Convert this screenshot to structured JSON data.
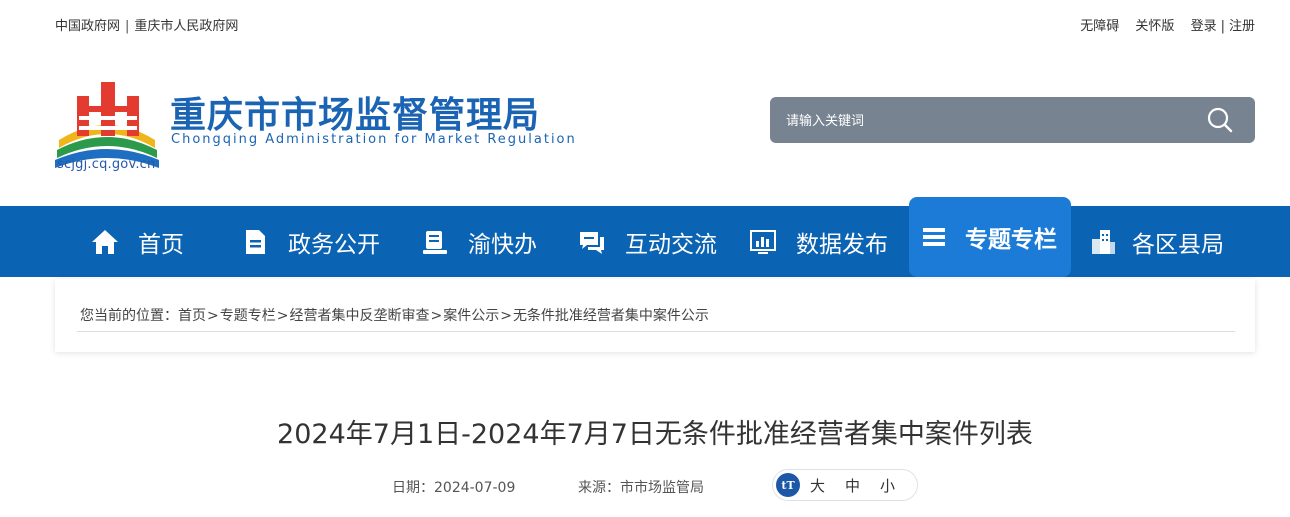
{
  "top_links": {
    "left": [
      "中国政府网",
      "重庆市人民政府网"
    ],
    "accessibility": "无障碍",
    "care": "关怀版",
    "login": "登录",
    "register": "注册"
  },
  "header": {
    "title": "重庆市市场监督管理局",
    "subtitle": "Chongqing  Administration for Market Regulation",
    "domain": "scjgj.cq.gov.cn"
  },
  "search": {
    "placeholder": "请输入关键词"
  },
  "nav": {
    "items": [
      {
        "label": "首页",
        "icon": "home-icon"
      },
      {
        "label": "政务公开",
        "icon": "document-icon"
      },
      {
        "label": "渝快办",
        "icon": "service-icon"
      },
      {
        "label": "互动交流",
        "icon": "chat-icon"
      },
      {
        "label": "数据发布",
        "icon": "chart-icon"
      },
      {
        "label": "专题专栏",
        "icon": "column-icon",
        "active": true
      },
      {
        "label": "各区县局",
        "icon": "building-icon"
      }
    ]
  },
  "breadcrumb": {
    "prefix": "您当前的位置：",
    "items": [
      "首页",
      "专题专栏",
      "经营者集中反垄断审查",
      "案件公示",
      "无条件批准经营者集中案件公示"
    ],
    "sep": ">"
  },
  "article": {
    "title": "2024年7月1日-2024年7月7日无条件批准经营者集中案件列表",
    "date": "日期：2024-07-09",
    "source": "来源：市市场监管局",
    "font_size_icon": "tT",
    "font_sizes": [
      "大",
      "中",
      "小"
    ]
  },
  "colors": {
    "nav_bg": "#0b63b3",
    "nav_active": "#1b7bd7",
    "brand_blue": "#1b64b4",
    "search_bg": "#778391"
  }
}
